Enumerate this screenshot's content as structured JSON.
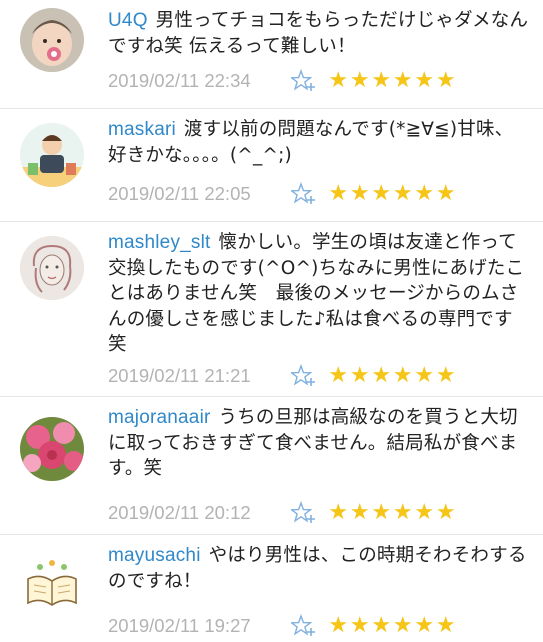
{
  "comments": [
    {
      "user": "U4Q",
      "text": "男性ってチョコをもらっただけじゃダメなんですね笑 伝えるって難しい！",
      "timestamp": "2019/02/11 22:34",
      "avatar_icon": "baby-photo-avatar",
      "rating": 6
    },
    {
      "user": "maskari",
      "text": "渡す以前の問題なんです(*≧∀≦)甘味、好きかな。。。。(^_^;)",
      "timestamp": "2019/02/11 22:05",
      "avatar_icon": "cartoon-character-avatar",
      "rating": 6
    },
    {
      "user": "mashley_slt",
      "text": "懐かしい。学生の頃は友達と作って交換したものです(^O^)ちなみに男性にあげたことはありません笑　最後のメッセージからのムさんの優しさを感じました♪私は食べるの専門です笑",
      "timestamp": "2019/02/11 21:21",
      "avatar_icon": "sketch-face-avatar",
      "rating": 6
    },
    {
      "user": "majoranaair",
      "text": "うちの旦那は高級なのを買うと大切に取っておきすぎて食べません。結局私が食べます。笑",
      "timestamp": "2019/02/11 20:12",
      "avatar_icon": "pink-roses-avatar",
      "rating": 6
    },
    {
      "user": "mayusachi",
      "text": "やはり男性は、この時期そわそわするのですね！",
      "timestamp": "2019/02/11 19:27",
      "avatar_icon": "open-book-avatar",
      "rating": 6
    }
  ],
  "star_glyph": "★",
  "colors": {
    "username": "#2f88c9",
    "timestamp": "#b3b3b3",
    "star": "#f5c518",
    "star_add": "#7fb0df"
  }
}
